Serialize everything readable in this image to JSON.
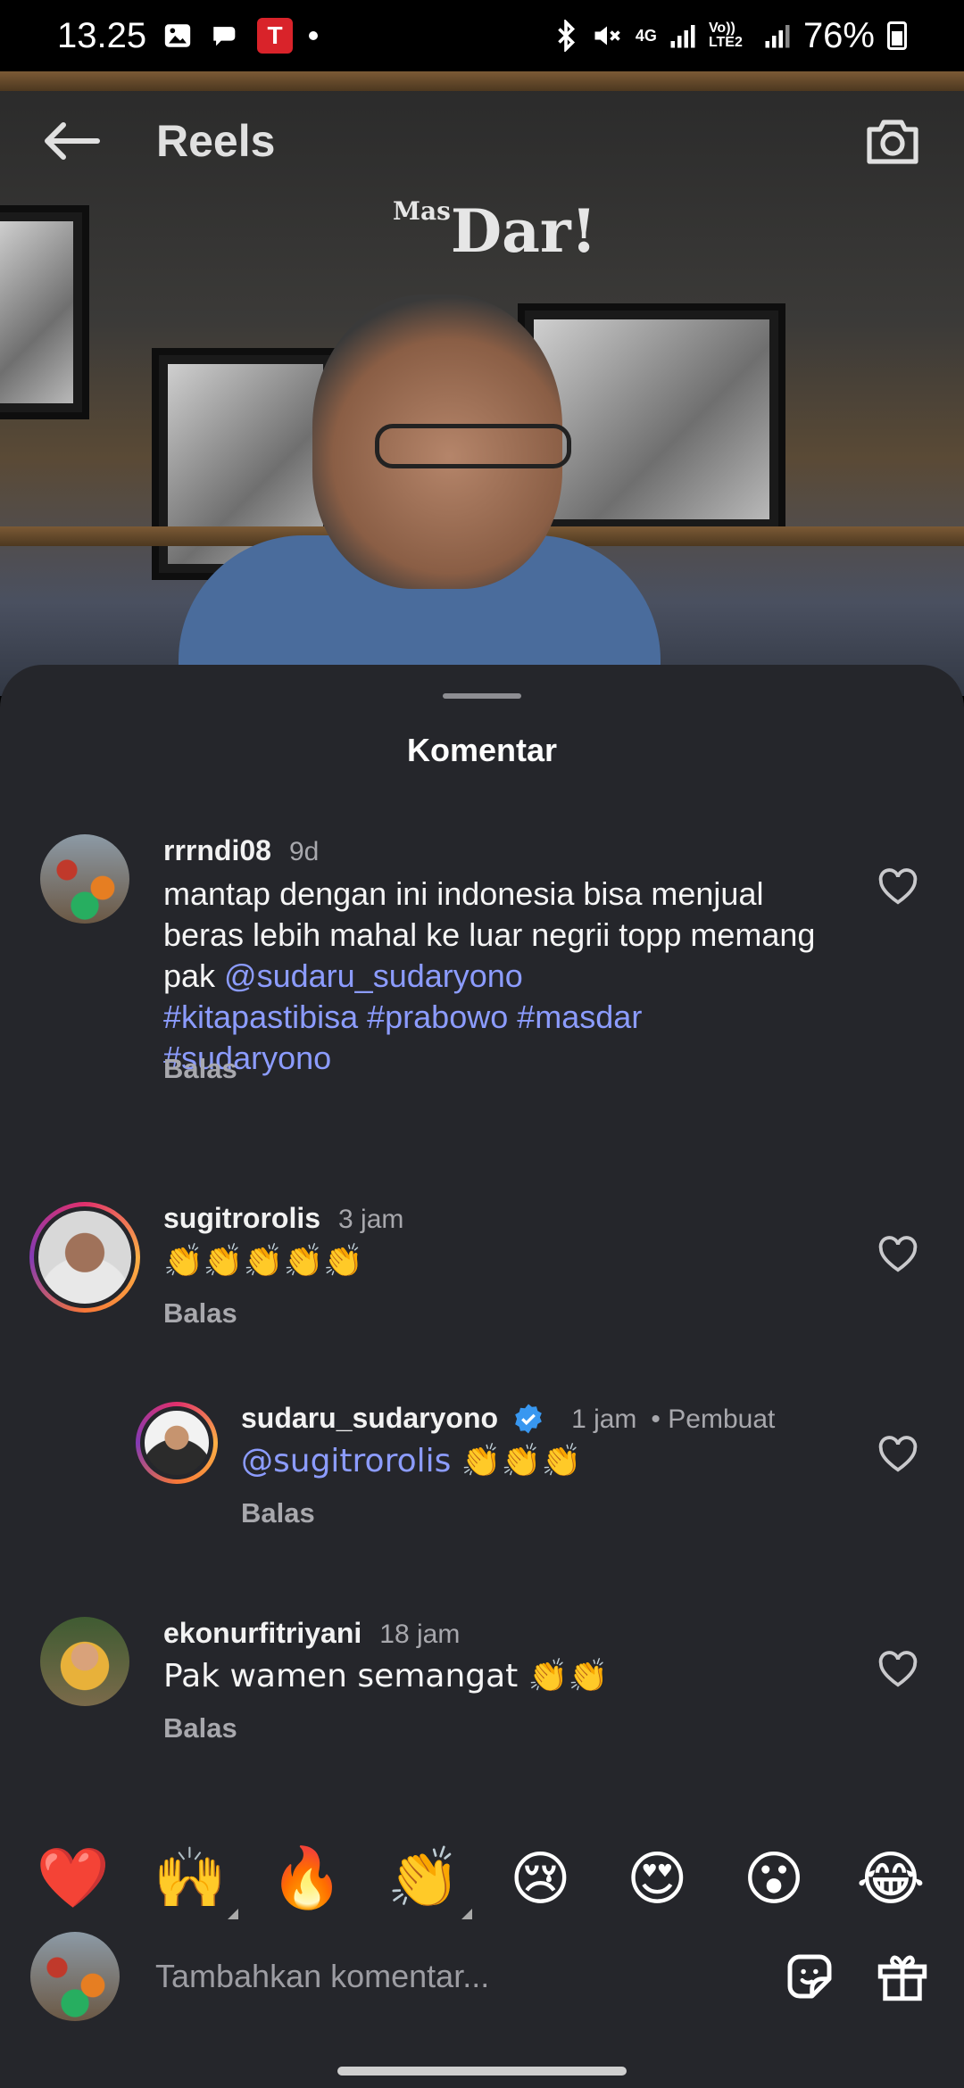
{
  "status_bar": {
    "time": "13.25",
    "network_4g": "4G",
    "volte": "Vo)) LTE2",
    "battery": "76%"
  },
  "header": {
    "title": "Reels",
    "back_icon": "arrow-left-icon",
    "camera_icon": "camera-icon"
  },
  "video": {
    "logo_prefix": "Mas",
    "logo_text": "Dar!"
  },
  "sheet": {
    "title": "Komentar"
  },
  "comments": [
    {
      "username": "rrrndi08",
      "time": "9d",
      "text_plain": "mantap dengan ini indonesia bisa menjual beras lebih mahal ke luar negrii topp memang pak ",
      "mention": "@sudaru_sudaryono",
      "hashtags_line1": "#kitapastibisa #prabowo #masdar",
      "hashtags_line2": "#sudaryono",
      "reply": "Balas"
    },
    {
      "username": "sugitrorolis",
      "time": "3 jam",
      "text_plain": "👏👏👏👏👏",
      "reply": "Balas"
    },
    {
      "username": "sudaru_sudaryono",
      "time": "1 jam",
      "label": "• Pembuat",
      "mention": "@sugitrorolis",
      "text_plain": " 👏👏👏",
      "reply": "Balas"
    },
    {
      "username": "ekonurfitriyani",
      "time": "18 jam",
      "text_plain": "Pak wamen semangat 👏👏",
      "reply": "Balas"
    }
  ],
  "emoji_bar": [
    "❤️",
    "🙌",
    "🔥",
    "👏",
    "😢",
    "😍",
    "😮",
    "😂"
  ],
  "input": {
    "placeholder": "Tambahkan komentar..."
  }
}
